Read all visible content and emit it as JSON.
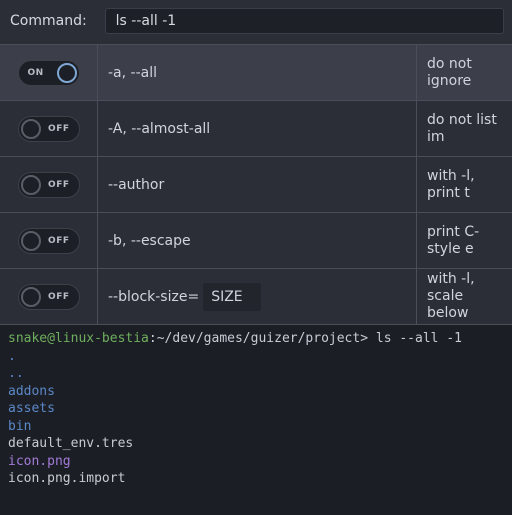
{
  "command": {
    "label": "Command:",
    "value": "ls --all -1"
  },
  "toggle_labels": {
    "on": "ON",
    "off": "OFF"
  },
  "options": [
    {
      "state": "on",
      "flag": "-a, --all",
      "desc": "do not ignore"
    },
    {
      "state": "off",
      "flag": "-A, --almost-all",
      "desc": "do not list im"
    },
    {
      "state": "off",
      "flag": "--author",
      "desc": "with -l, print t"
    },
    {
      "state": "off",
      "flag": "-b, --escape",
      "desc": "print C-style e"
    },
    {
      "state": "off",
      "flag": "--block-size=",
      "arg": "SIZE",
      "desc": "with -l, scale below"
    }
  ],
  "terminal": {
    "prompt_user_host": "snake@linux-bestia",
    "prompt_path": ":~/dev/games/guizer/project>",
    "prompt_cmd": " ls --all -1",
    "output": [
      {
        "cls": "out-dot",
        "text": "."
      },
      {
        "cls": "out-dot",
        "text": ".."
      },
      {
        "cls": "out-dir",
        "text": "addons"
      },
      {
        "cls": "out-dir",
        "text": "assets"
      },
      {
        "cls": "out-dir",
        "text": "bin"
      },
      {
        "cls": "out-file",
        "text": "default_env.tres"
      },
      {
        "cls": "out-png",
        "text": "icon.png"
      },
      {
        "cls": "out-file",
        "text": "icon.png.import"
      }
    ]
  }
}
